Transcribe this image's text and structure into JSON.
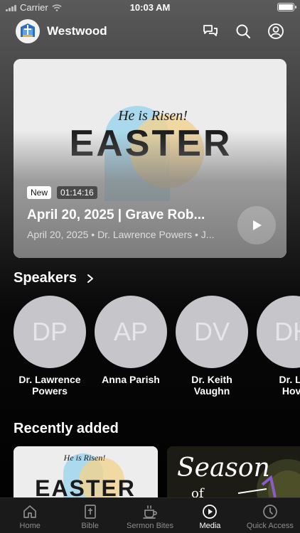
{
  "status_bar": {
    "carrier": "Carrier",
    "time": "10:03 AM"
  },
  "header": {
    "church_name": "Westwood",
    "icons": [
      "chat-icon",
      "search-icon",
      "profile-icon"
    ]
  },
  "hero": {
    "art_script": "He is Risen!",
    "art_title": "EASTER",
    "badge_new": "New",
    "duration": "01:14:16",
    "title": "April 20, 2025 | Grave Rob...",
    "meta": "April 20, 2025 • Dr. Lawrence Powers • J..."
  },
  "speakers": {
    "heading": "Speakers",
    "items": [
      {
        "initials": "DP",
        "name": "Dr. Lawrence\nPowers"
      },
      {
        "initials": "AP",
        "name": "Anna Parish"
      },
      {
        "initials": "DV",
        "name": "Dr. Keith\nVaughn"
      },
      {
        "initials": "DH",
        "name": "Dr. La\nHovi"
      }
    ]
  },
  "recent": {
    "heading": "Recently added",
    "cards": [
      {
        "script": "He is Risen!",
        "title": "EASTER"
      },
      {
        "script": "Season",
        "subtitle": "of"
      }
    ]
  },
  "tabs": [
    {
      "label": "Home",
      "icon": "home-icon",
      "active": false
    },
    {
      "label": "Bible",
      "icon": "bible-icon",
      "active": false
    },
    {
      "label": "Sermon Bites",
      "icon": "coffee-cup-icon",
      "active": false
    },
    {
      "label": "Media",
      "icon": "play-circle-icon",
      "active": true
    },
    {
      "label": "Quick Access",
      "icon": "clock-icon",
      "active": false
    }
  ],
  "colors": {
    "background_top": "#5a5a5a",
    "background_bottom": "#000000",
    "avatar": "#c5c5ca",
    "tab_inactive": "#8d8d8d",
    "tab_active": "#ffffff"
  }
}
